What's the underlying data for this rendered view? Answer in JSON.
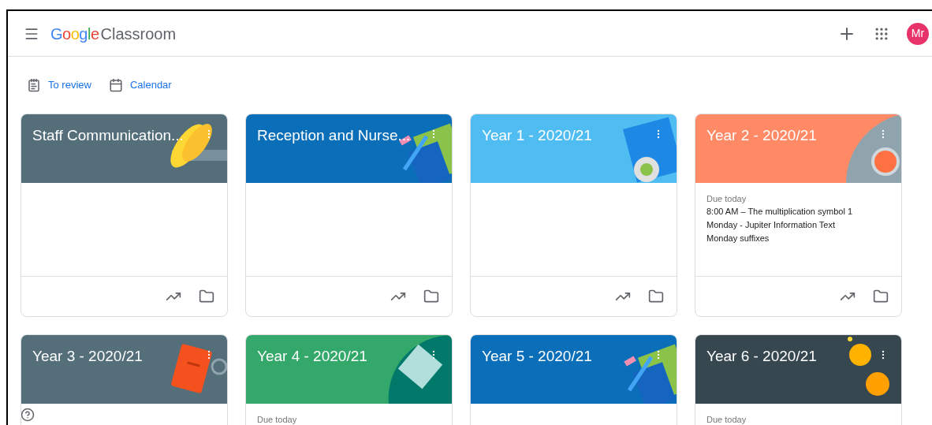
{
  "header": {
    "brand": "Google",
    "product": "Classroom",
    "avatar": "Mr"
  },
  "nav": [
    {
      "kind": "review",
      "label": "To review"
    },
    {
      "kind": "calendar",
      "label": "Calendar"
    }
  ],
  "classes": [
    {
      "title": "Staff Communication...",
      "color": "#546e7a",
      "kind": "weights"
    },
    {
      "title": "Reception and Nurse...",
      "color": "#0a6fb8",
      "kind": "pencil"
    },
    {
      "title": "Year 1 - 2020/21",
      "color": "#4fbcf2",
      "kind": "plate"
    },
    {
      "title": "Year 2 - 2020/21",
      "color": "#ff8a65",
      "kind": "fruit",
      "due_label": "Due today",
      "due": [
        "8:00 AM – The multiplication symbol 1",
        "Monday - Jupiter Information Text",
        "Monday suffixes"
      ]
    },
    {
      "title": "Year 3 - 2020/21",
      "color": "#546e7a",
      "kind": "book"
    },
    {
      "title": "Year 4 - 2020/21",
      "color": "#33a86a",
      "kind": "notebook",
      "due_label": "Due today"
    },
    {
      "title": "Year 5 - 2020/21",
      "color": "#0a6fb8",
      "kind": "pencil"
    },
    {
      "title": "Year 6 - 2020/21",
      "color": "#37474f",
      "kind": "coins",
      "due_label": "Due today"
    }
  ]
}
